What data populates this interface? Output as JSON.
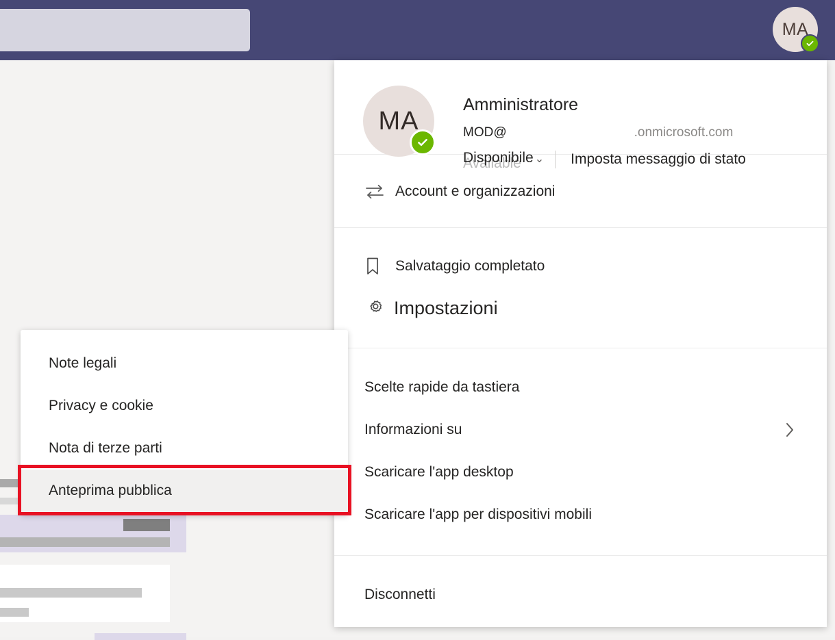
{
  "theme": {
    "header_purple": "#464775",
    "avatar_bg": "#e8dfdc",
    "presence_green": "#6bb700",
    "annotation_red": "#e81123",
    "selected_row_bg": "#f1f0ef",
    "search_box_bg": "#d6d5e0"
  },
  "top_bar": {
    "avatar_initials": "MA",
    "presence_icon": "check-icon",
    "search_placeholder": ""
  },
  "profile": {
    "avatar_initials": "MA",
    "display_name": "Amministratore",
    "email_local": "MOD@",
    "email_domain": ".onmicrosoft.com",
    "status_current": "Disponibile",
    "status_underlay": "Available",
    "status_chevron": "⌄",
    "status_message_label": "Imposta messaggio di stato"
  },
  "menu": {
    "account_group": [
      {
        "label": "Account e organizzazioni",
        "icon": "swap-arrows-icon"
      }
    ],
    "saved_group": [
      {
        "label": "Salvataggio completato",
        "icon": "bookmark-icon"
      },
      {
        "label": "Impostazioni",
        "icon": "gear-icon"
      }
    ],
    "links_group": [
      {
        "label": "Scelte rapide da tastiera",
        "icon": null,
        "chevron": false
      },
      {
        "label": "Informazioni su",
        "icon": null,
        "chevron": true
      },
      {
        "label": "Scaricare l'app desktop",
        "icon": null,
        "chevron": false
      },
      {
        "label": "Scaricare l'app per dispositivi mobili",
        "icon": null,
        "chevron": false
      }
    ],
    "signout_group": [
      {
        "label": "Disconnetti",
        "icon": null
      }
    ]
  },
  "submenu": {
    "items": [
      {
        "label": "Note legali",
        "selected": false
      },
      {
        "label": "Privacy e cookie",
        "selected": false
      },
      {
        "label": "Nota di terze parti",
        "selected": false
      },
      {
        "label": "Anteprima pubblica",
        "selected": true
      }
    ]
  },
  "annotation": {
    "target_label": "Anteprima pubblica",
    "color": "#e81123"
  }
}
